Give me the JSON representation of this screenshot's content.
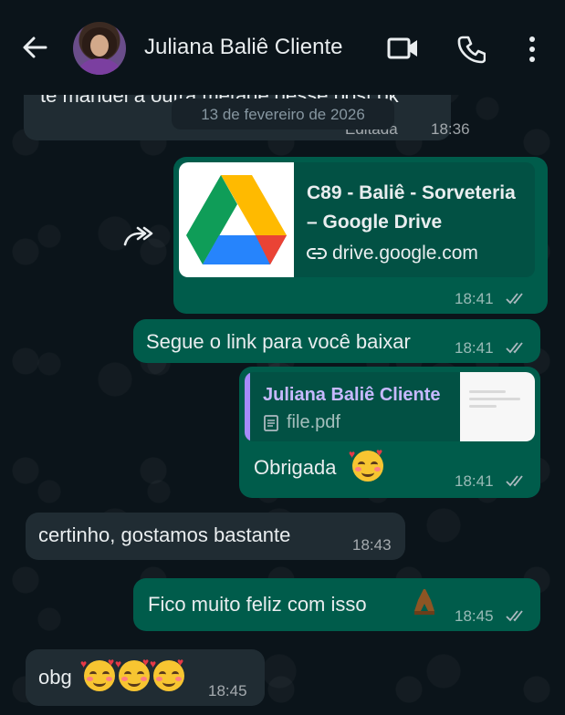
{
  "header": {
    "contact_name": "Juliana Baliê Cliente",
    "back_icon": "arrow-left-icon",
    "video_icon": "video-call-icon",
    "phone_icon": "phone-call-icon",
    "menu_icon": "more-vert-icon"
  },
  "chat": {
    "partial_message": {
      "text": "te mandei a outra metade desse post ok",
      "time": "18:36",
      "edited_label": "Editada"
    },
    "date_separator": "13 de fevereiro de 2026",
    "link_preview_message": {
      "title_line1": "C89 - Baliê - Sorveteria",
      "title_line2": "– Google Drive",
      "domain": "drive.google.com",
      "time": "18:41",
      "thumbnail_icon": "google-drive-icon",
      "link_icon": "link-icon",
      "forward_icon": "forward-icon"
    },
    "messages": [
      {
        "id": "m1",
        "direction": "outgoing",
        "text": "Segue o link para você baixar",
        "time": "18:41"
      },
      {
        "id": "m2",
        "direction": "outgoing",
        "text": "Obrigada",
        "time": "18:41",
        "reply": {
          "author": "Juliana Baliê Cliente",
          "file_name": "file.pdf",
          "file_icon": "document-icon"
        }
      },
      {
        "id": "m3",
        "direction": "incoming",
        "text": "certinho, gostamos bastante",
        "time": "18:43"
      },
      {
        "id": "m4",
        "direction": "outgoing",
        "text": "Fico muito feliz com isso",
        "time": "18:45"
      },
      {
        "id": "m5",
        "direction": "incoming",
        "text": "obg",
        "time": "18:45"
      }
    ]
  },
  "colors": {
    "background": "#0b141a",
    "incoming_bubble": "#202c33",
    "outgoing_bubble": "#005c4b",
    "quote_accent": "#a78bfa"
  }
}
